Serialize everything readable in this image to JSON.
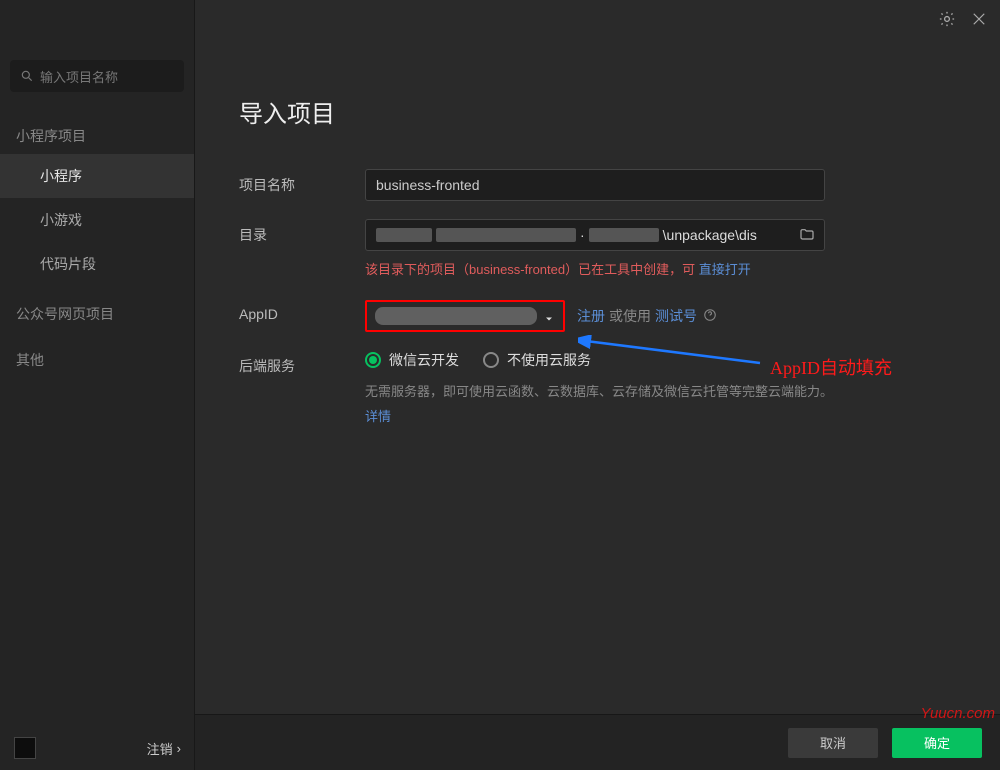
{
  "titlebar": {
    "settings_icon": "gear",
    "close_icon": "close"
  },
  "search": {
    "placeholder": "输入项目名称"
  },
  "sidebar": {
    "groups": [
      {
        "head": "小程序项目",
        "items": [
          "小程序",
          "小游戏",
          "代码片段"
        ],
        "activeIndex": 0
      },
      {
        "head": "公众号网页项目",
        "items": []
      },
      {
        "head": "其他",
        "items": []
      }
    ],
    "logout": "注销"
  },
  "main": {
    "title": "导入项目",
    "labels": {
      "project_name": "项目名称",
      "directory": "目录",
      "appid": "AppID",
      "backend": "后端服务"
    },
    "project_name_value": "business-fronted",
    "directory_value_suffix": "\\unpackage\\dis",
    "dir_warn_prefix": "该目录下的项目（business-fronted）已在工具中创建，可",
    "dir_warn_link": "直接打开",
    "appid_links": {
      "register": "注册",
      "or_use": "或使用",
      "test": "测试号"
    },
    "backend": {
      "option_cloud": "微信云开发",
      "option_none": "不使用云服务",
      "desc": "无需服务器，即可使用云函数、云数据库、云存储及微信云托管等完整云端能力。",
      "details_link": "详情"
    }
  },
  "footer": {
    "cancel": "取消",
    "ok": "确定"
  },
  "annotation": {
    "text": "AppID自动填充"
  },
  "watermark": {
    "text": "Yuucn.com"
  }
}
